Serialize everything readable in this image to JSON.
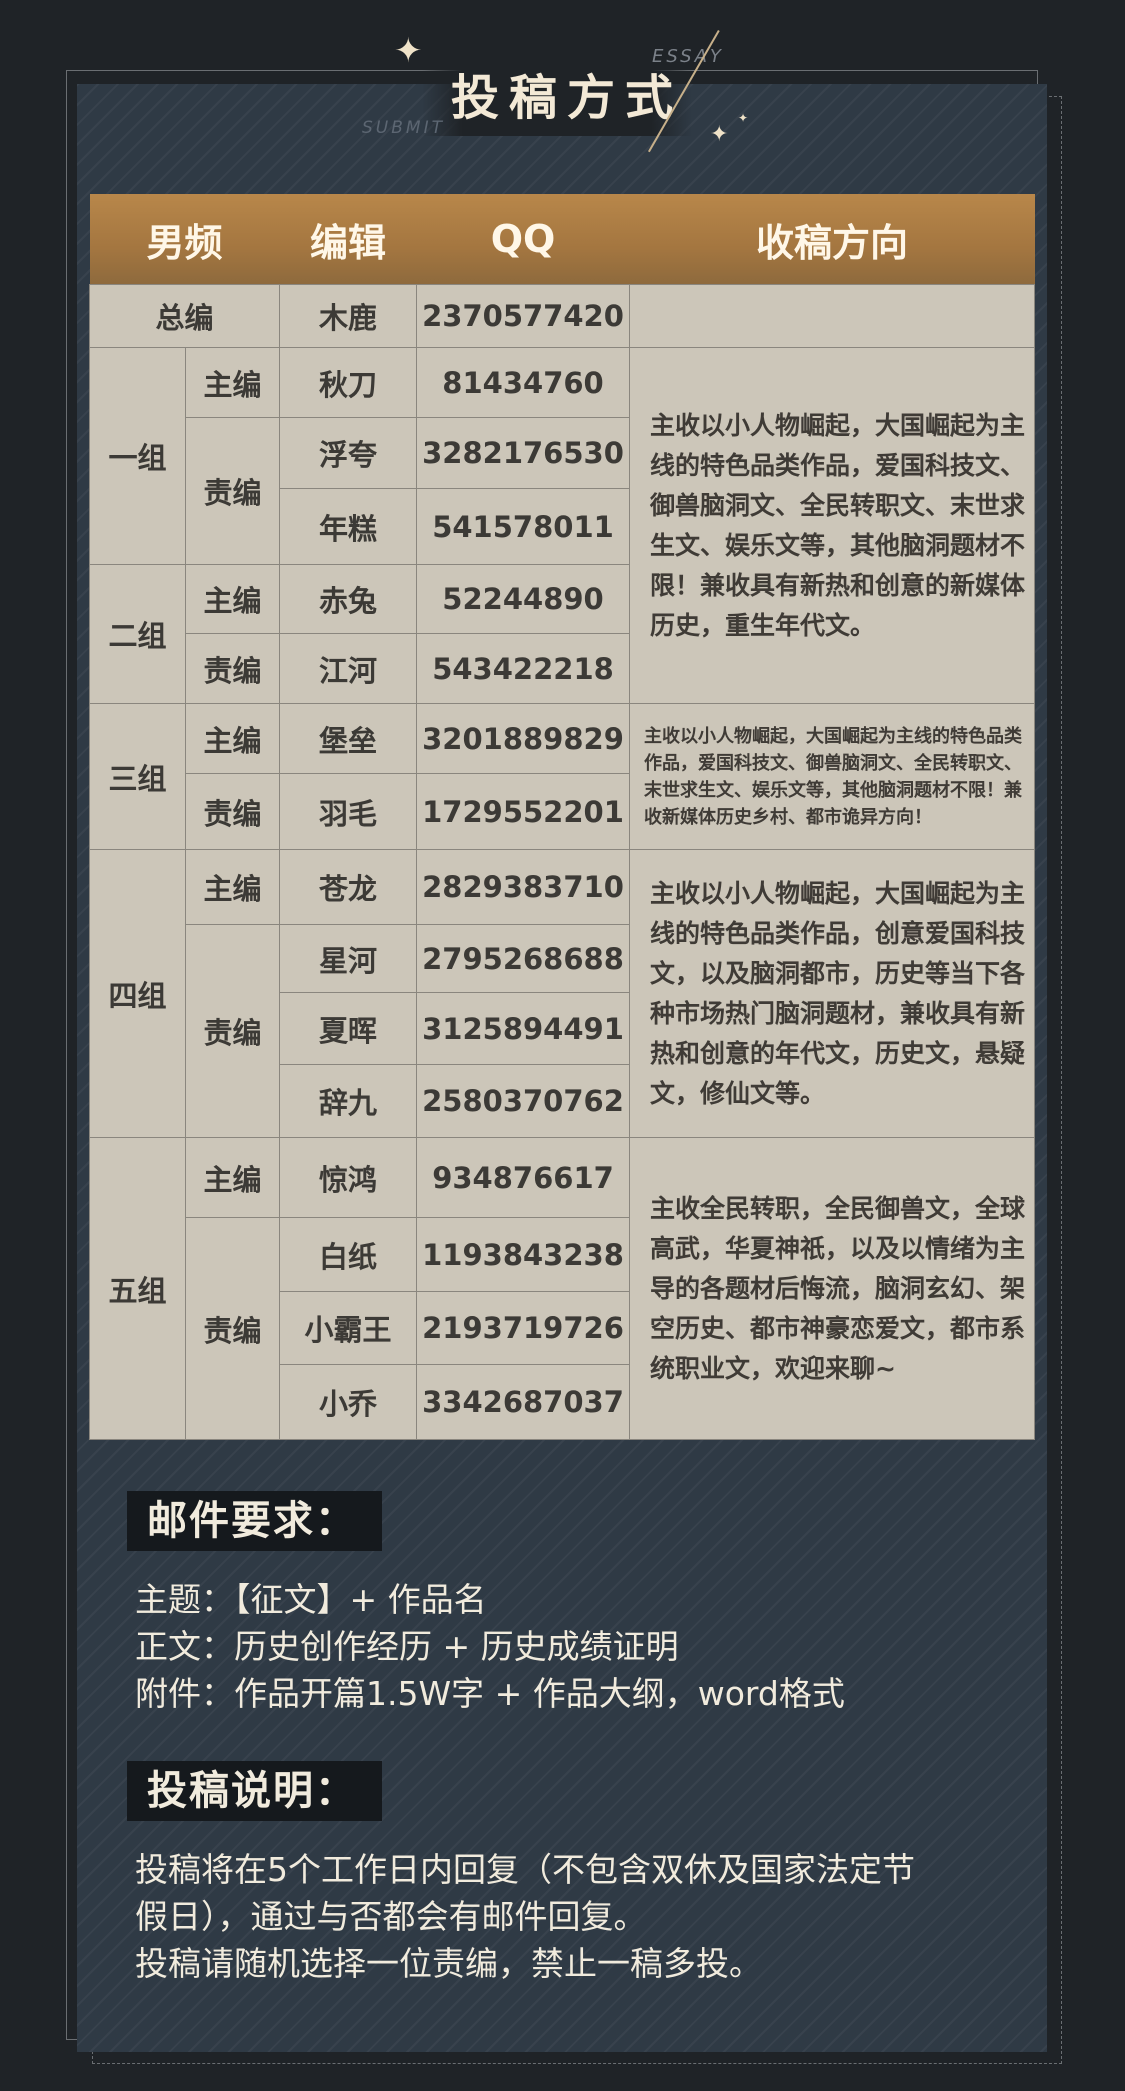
{
  "header": {
    "title": "投稿方式",
    "en_top": "ESSAY",
    "en_bottom": "SUBMIT"
  },
  "table": {
    "headers": [
      "男频",
      "编辑",
      "QQ",
      "收稿方向"
    ],
    "chief": {
      "label": "总编",
      "name": "木鹿",
      "qq": "2370577420"
    },
    "groups": [
      {
        "name": "一组",
        "members": [
          {
            "role": "主编",
            "name": "秋刀",
            "qq": "81434760"
          },
          {
            "role": "责编",
            "name": "浮夸",
            "qq": "3282176530"
          },
          {
            "name": "年糕",
            "qq": "541578011"
          }
        ]
      },
      {
        "name": "二组",
        "members": [
          {
            "role": "主编",
            "name": "赤兔",
            "qq": "52244890"
          },
          {
            "role": "责编",
            "name": "江河",
            "qq": "543422218"
          }
        ]
      },
      {
        "name": "三组",
        "members": [
          {
            "role": "主编",
            "name": "堡垒",
            "qq": "3201889829"
          },
          {
            "role": "责编",
            "name": "羽毛",
            "qq": "1729552201"
          }
        ]
      },
      {
        "name": "四组",
        "members": [
          {
            "role": "主编",
            "name": "苍龙",
            "qq": "2829383710"
          },
          {
            "role": "责编",
            "name": "星河",
            "qq": "2795268688"
          },
          {
            "name": "夏晖",
            "qq": "3125894491"
          },
          {
            "name": "辞九",
            "qq": "2580370762"
          }
        ]
      },
      {
        "name": "五组",
        "members": [
          {
            "role": "主编",
            "name": "惊鸿",
            "qq": "934876617"
          },
          {
            "role": "责编",
            "name": "白纸",
            "qq": "1193843238"
          },
          {
            "name": "小霸王",
            "qq": "2193719726"
          },
          {
            "name": "小乔",
            "qq": "3342687037"
          }
        ]
      }
    ],
    "directions": {
      "g12": "主收以小人物崛起，大国崛起为主线的特色品类作品，爱国科技文、御兽脑洞文、全民转职文、末世求生文、娱乐文等，其他脑洞题材不限！兼收具有新热和创意的新媒体历史，重生年代文。",
      "g3": "主收以小人物崛起，大国崛起为主线的特色品类作品，爱国科技文、御兽脑洞文、全民转职文、末世求生文、娱乐文等，其他脑洞题材不限！兼收新媒体历史乡村、都市诡异方向！",
      "g4": "主收以小人物崛起，大国崛起为主线的特色品类作品，创意爱国科技文，以及脑洞都市，历史等当下各种市场热门脑洞题材，兼收具有新热和创意的年代文，历史文，悬疑文，修仙文等。",
      "g5": "主收全民转职，全民御兽文，全球高武，华夏神祇，以及以情绪为主导的各题材后悔流，脑洞玄幻、架空历史、都市神豪恋爱文，都市系统职业文，欢迎来聊~"
    }
  },
  "email": {
    "heading": "邮件要求：",
    "lines": [
      "主题：【征文】+ 作品名",
      "正文：历史创作经历 + 历史成绩证明",
      "附件：作品开篇1.5W字 + 作品大纲，word格式"
    ]
  },
  "notes": {
    "heading": "投稿说明：",
    "lines": [
      "投稿将在5个工作日内回复（不包含双休及国家法定节",
      "假日），通过与否都会有邮件回复。",
      "投稿请随机选择一位责编，禁止一稿多投。"
    ]
  }
}
